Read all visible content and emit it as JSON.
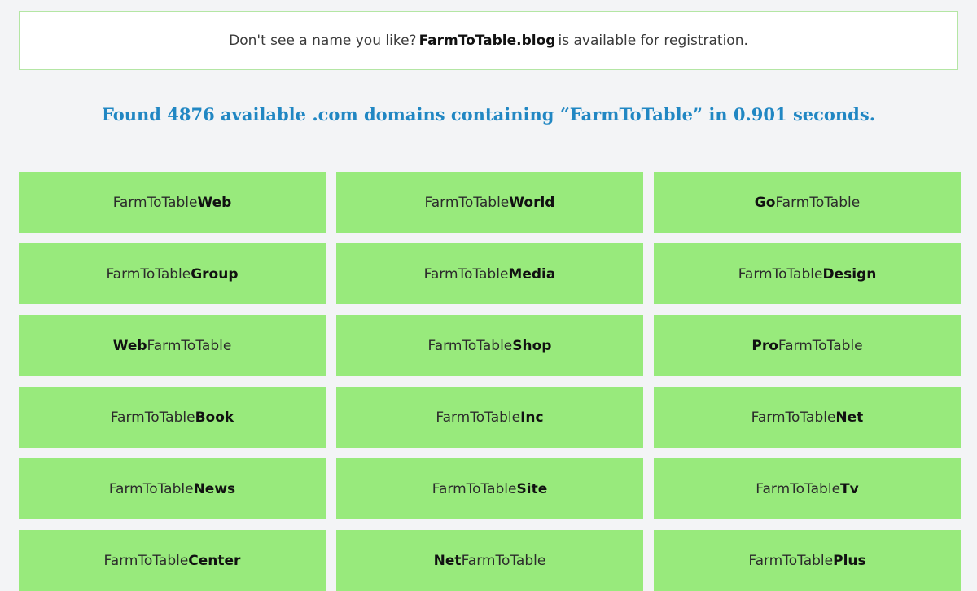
{
  "notice": {
    "before": "Don't see a name you like?",
    "domain": "FarmToTable.blog",
    "after": "is available for registration."
  },
  "results": {
    "heading": "Found 4876 available .com domains containing “FarmToTable” in 0.901 seconds."
  },
  "domains": [
    {
      "normal": "FarmToTable",
      "bold": "Web",
      "bold_first": false
    },
    {
      "normal": "FarmToTable",
      "bold": "World",
      "bold_first": false
    },
    {
      "normal": "FarmToTable",
      "bold": "Go",
      "bold_first": true
    },
    {
      "normal": "FarmToTable",
      "bold": "Group",
      "bold_first": false
    },
    {
      "normal": "FarmToTable",
      "bold": "Media",
      "bold_first": false
    },
    {
      "normal": "FarmToTable",
      "bold": "Design",
      "bold_first": false
    },
    {
      "normal": "FarmToTable",
      "bold": "Web",
      "bold_first": true
    },
    {
      "normal": "FarmToTable",
      "bold": "Shop",
      "bold_first": false
    },
    {
      "normal": "FarmToTable",
      "bold": "Pro",
      "bold_first": true
    },
    {
      "normal": "FarmToTable",
      "bold": "Book",
      "bold_first": false
    },
    {
      "normal": "FarmToTable",
      "bold": "Inc",
      "bold_first": false
    },
    {
      "normal": "FarmToTable",
      "bold": "Net",
      "bold_first": false
    },
    {
      "normal": "FarmToTable",
      "bold": "News",
      "bold_first": false
    },
    {
      "normal": "FarmToTable",
      "bold": "Site",
      "bold_first": false
    },
    {
      "normal": "FarmToTable",
      "bold": "Tv",
      "bold_first": false
    },
    {
      "normal": "FarmToTable",
      "bold": "Center",
      "bold_first": false
    },
    {
      "normal": "FarmToTable",
      "bold": "Net",
      "bold_first": true
    },
    {
      "normal": "FarmToTable",
      "bold": "Plus",
      "bold_first": false
    }
  ],
  "colors": {
    "card_bg": "#98ea7c",
    "heading": "#2187c3",
    "notice_border": "#b4e6a4",
    "page_bg": "#f3f4f6"
  }
}
